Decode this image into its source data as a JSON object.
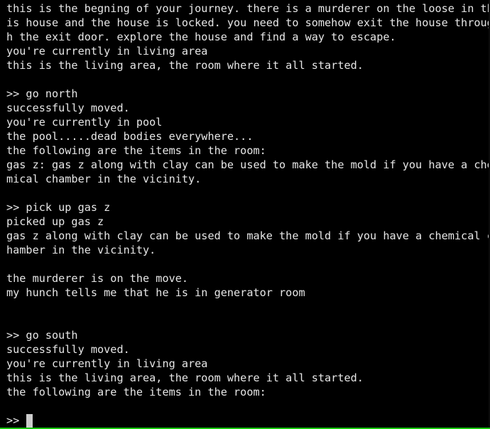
{
  "terminal": {
    "lines": [
      "this is the begning of your journey. there is a murderer on the loose in th",
      "is house and the house is locked. you need to somehow exit the house throug",
      "h the exit door. explore the house and find a way to escape.",
      "you're currently in living area",
      "this is the living area, the room where it all started.",
      "",
      ">> go north",
      "successfully moved.",
      "you're currently in pool",
      "the pool.....dead bodies everywhere...",
      "the following are the items in the room:",
      "gas z: gas z along with clay can be used to make the mold if you have a che",
      "mical chamber in the vicinity.",
      "",
      ">> pick up gas z",
      "picked up gas z",
      "gas z along with clay can be used to make the mold if you have a chemical c",
      "hamber in the vicinity.",
      "",
      "the murderer is on the move.",
      "my hunch tells me that he is in generator room",
      "",
      "",
      ">> go south",
      "successfully moved.",
      "you're currently in living area",
      "this is the living area, the room where it all started.",
      "the following are the items in the room:",
      ""
    ],
    "prompt": ">>",
    "text_color": "#e6e6e6",
    "background_color": "#000000",
    "accent_color": "#16c60c"
  }
}
